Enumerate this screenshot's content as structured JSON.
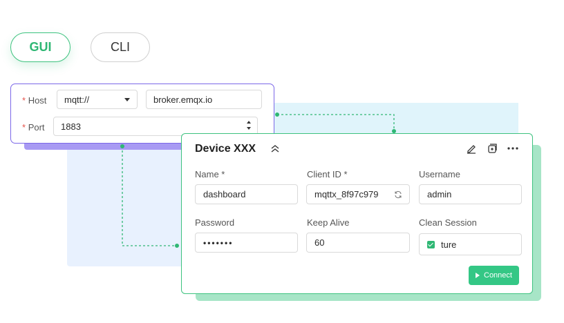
{
  "mode_toggle": {
    "gui_label": "GUI",
    "cli_label": "CLI"
  },
  "host_card": {
    "host_label": "Host",
    "port_label": "Port",
    "required_mark": "*",
    "protocol_value": "mqtt://",
    "host_value": "broker.emqx.io",
    "port_value": "1883"
  },
  "device_card": {
    "title": "Device XXX",
    "fields": {
      "name_label": "Name *",
      "name_value": "dashboard",
      "client_id_label": "Client ID *",
      "client_id_value": "mqttx_8f97c979",
      "username_label": "Username",
      "username_value": "admin",
      "password_label": "Password",
      "password_value": "•••••••",
      "keep_alive_label": "Keep Alive",
      "keep_alive_value": "60",
      "clean_session_label": "Clean Session",
      "clean_session_value": "ture"
    },
    "connect_label": "Connect"
  },
  "icons": [
    "edit-icon",
    "add-window-icon",
    "more-icon",
    "collapse-icon",
    "refresh-icon",
    "play-icon",
    "caret-down-icon",
    "stepper-icon"
  ],
  "colors": {
    "accent_green": "#3cc27e",
    "accent_purple": "#7b67e8",
    "required_red": "#e5534b"
  }
}
